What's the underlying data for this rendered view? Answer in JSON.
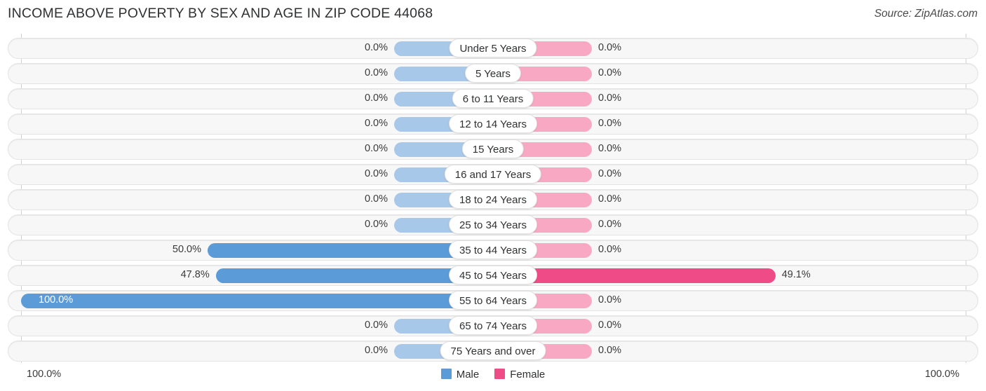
{
  "header": {
    "title": "INCOME ABOVE POVERTY BY SEX AND AGE IN ZIP CODE 44068",
    "source": "Source: ZipAtlas.com"
  },
  "footer": {
    "axis_left_label": "100.0%",
    "axis_right_label": "100.0%",
    "legend": [
      {
        "label": "Male",
        "color": "#5b9bd8",
        "key": "male"
      },
      {
        "label": "Female",
        "color": "#ef4b87",
        "key": "female"
      }
    ]
  },
  "chart_data": {
    "type": "bar",
    "orientation": "horizontal",
    "style": "diverging-bidirectional",
    "title": "INCOME ABOVE POVERTY BY SEX AND AGE IN ZIP CODE 44068",
    "xlabel": "",
    "ylabel": "",
    "xlim": [
      0,
      100
    ],
    "grid": false,
    "legend_position": "bottom-center",
    "categories": [
      "Under 5 Years",
      "5 Years",
      "6 to 11 Years",
      "12 to 14 Years",
      "15 Years",
      "16 and 17 Years",
      "18 to 24 Years",
      "25 to 34 Years",
      "35 to 44 Years",
      "45 to 54 Years",
      "55 to 64 Years",
      "65 to 74 Years",
      "75 Years and over"
    ],
    "series": [
      {
        "name": "Male",
        "color": "#5b9bd8",
        "values": [
          0.0,
          0.0,
          0.0,
          0.0,
          0.0,
          0.0,
          0.0,
          0.0,
          50.0,
          47.8,
          100.0,
          0.0,
          0.0
        ],
        "labels": [
          "0.0%",
          "0.0%",
          "0.0%",
          "0.0%",
          "0.0%",
          "0.0%",
          "0.0%",
          "0.0%",
          "50.0%",
          "47.8%",
          "100.0%",
          "0.0%",
          "0.0%"
        ]
      },
      {
        "name": "Female",
        "color": "#ef4b87",
        "values": [
          0.0,
          0.0,
          0.0,
          0.0,
          0.0,
          0.0,
          0.0,
          0.0,
          0.0,
          49.1,
          0.0,
          0.0,
          0.0
        ],
        "labels": [
          "0.0%",
          "0.0%",
          "0.0%",
          "0.0%",
          "0.0%",
          "0.0%",
          "0.0%",
          "0.0%",
          "0.0%",
          "49.1%",
          "0.0%",
          "0.0%",
          "0.0%"
        ]
      }
    ]
  }
}
